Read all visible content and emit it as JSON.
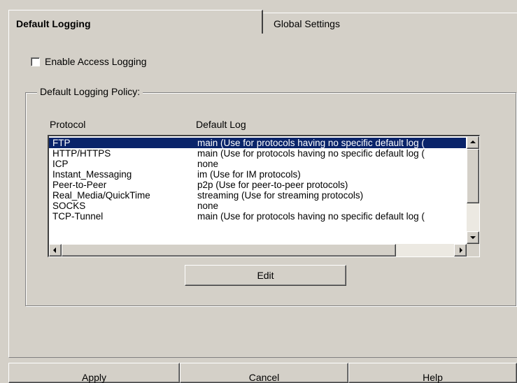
{
  "tabs": {
    "active_label": "Default Logging",
    "inactive_label": "Global Settings"
  },
  "enable_access_logging": {
    "label": "Enable Access Logging",
    "checked": false
  },
  "group": {
    "label": "Default Logging Policy:",
    "columns": {
      "protocol": "Protocol",
      "default_log": "Default Log"
    },
    "rows": [
      {
        "protocol": "FTP",
        "log": "main (Use for protocols having no specific default log (",
        "selected": true
      },
      {
        "protocol": "HTTP/HTTPS",
        "log": " main (Use for protocols having no specific default log (",
        "selected": false
      },
      {
        "protocol": "ICP",
        "log": "none",
        "selected": false
      },
      {
        "protocol": "Instant_Messaging",
        "log": "im (Use for IM protocols)",
        "selected": false
      },
      {
        "protocol": "Peer-to-Peer",
        "log": "p2p (Use for peer-to-peer protocols)",
        "selected": false
      },
      {
        "protocol": "Real_Media/QuickTime",
        "log": "streaming (Use for streaming protocols)",
        "selected": false
      },
      {
        "protocol": "SOCKS",
        "log": "none",
        "selected": false
      },
      {
        "protocol": "TCP-Tunnel",
        "log": "main (Use for protocols having no specific default log (",
        "selected": false
      }
    ],
    "edit_label": "Edit"
  },
  "footer": {
    "apply_label": "Apply",
    "cancel_label": "Cancel",
    "help_label": "Help"
  },
  "colors": {
    "window_bg": "#d4d0c8",
    "selection_bg": "#0a246a",
    "selection_fg": "#ffffff"
  }
}
